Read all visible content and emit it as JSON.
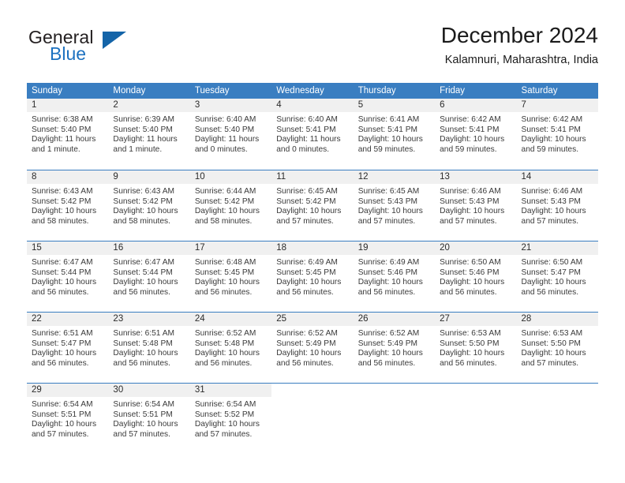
{
  "brand": {
    "word_one": "General",
    "word_two": "Blue",
    "triangle_icon": "triangle-icon"
  },
  "header": {
    "title": "December 2024",
    "subtitle": "Kalamnuri, Maharashtra, India"
  },
  "colors": {
    "header_blue": "#3a7ec1",
    "brand_blue": "#1c71c0",
    "triangle_blue": "#1464a8",
    "day_number_band": "#f0f0f0",
    "text": "#1a1a1a"
  },
  "calendar": {
    "weekdays": [
      "Sunday",
      "Monday",
      "Tuesday",
      "Wednesday",
      "Thursday",
      "Friday",
      "Saturday"
    ],
    "weeks": [
      [
        {
          "day": "1",
          "sunrise": "Sunrise: 6:38 AM",
          "sunset": "Sunset: 5:40 PM",
          "daylight": "Daylight: 11 hours and 1 minute."
        },
        {
          "day": "2",
          "sunrise": "Sunrise: 6:39 AM",
          "sunset": "Sunset: 5:40 PM",
          "daylight": "Daylight: 11 hours and 1 minute."
        },
        {
          "day": "3",
          "sunrise": "Sunrise: 6:40 AM",
          "sunset": "Sunset: 5:40 PM",
          "daylight": "Daylight: 11 hours and 0 minutes."
        },
        {
          "day": "4",
          "sunrise": "Sunrise: 6:40 AM",
          "sunset": "Sunset: 5:41 PM",
          "daylight": "Daylight: 11 hours and 0 minutes."
        },
        {
          "day": "5",
          "sunrise": "Sunrise: 6:41 AM",
          "sunset": "Sunset: 5:41 PM",
          "daylight": "Daylight: 10 hours and 59 minutes."
        },
        {
          "day": "6",
          "sunrise": "Sunrise: 6:42 AM",
          "sunset": "Sunset: 5:41 PM",
          "daylight": "Daylight: 10 hours and 59 minutes."
        },
        {
          "day": "7",
          "sunrise": "Sunrise: 6:42 AM",
          "sunset": "Sunset: 5:41 PM",
          "daylight": "Daylight: 10 hours and 59 minutes."
        }
      ],
      [
        {
          "day": "8",
          "sunrise": "Sunrise: 6:43 AM",
          "sunset": "Sunset: 5:42 PM",
          "daylight": "Daylight: 10 hours and 58 minutes."
        },
        {
          "day": "9",
          "sunrise": "Sunrise: 6:43 AM",
          "sunset": "Sunset: 5:42 PM",
          "daylight": "Daylight: 10 hours and 58 minutes."
        },
        {
          "day": "10",
          "sunrise": "Sunrise: 6:44 AM",
          "sunset": "Sunset: 5:42 PM",
          "daylight": "Daylight: 10 hours and 58 minutes."
        },
        {
          "day": "11",
          "sunrise": "Sunrise: 6:45 AM",
          "sunset": "Sunset: 5:42 PM",
          "daylight": "Daylight: 10 hours and 57 minutes."
        },
        {
          "day": "12",
          "sunrise": "Sunrise: 6:45 AM",
          "sunset": "Sunset: 5:43 PM",
          "daylight": "Daylight: 10 hours and 57 minutes."
        },
        {
          "day": "13",
          "sunrise": "Sunrise: 6:46 AM",
          "sunset": "Sunset: 5:43 PM",
          "daylight": "Daylight: 10 hours and 57 minutes."
        },
        {
          "day": "14",
          "sunrise": "Sunrise: 6:46 AM",
          "sunset": "Sunset: 5:43 PM",
          "daylight": "Daylight: 10 hours and 57 minutes."
        }
      ],
      [
        {
          "day": "15",
          "sunrise": "Sunrise: 6:47 AM",
          "sunset": "Sunset: 5:44 PM",
          "daylight": "Daylight: 10 hours and 56 minutes."
        },
        {
          "day": "16",
          "sunrise": "Sunrise: 6:47 AM",
          "sunset": "Sunset: 5:44 PM",
          "daylight": "Daylight: 10 hours and 56 minutes."
        },
        {
          "day": "17",
          "sunrise": "Sunrise: 6:48 AM",
          "sunset": "Sunset: 5:45 PM",
          "daylight": "Daylight: 10 hours and 56 minutes."
        },
        {
          "day": "18",
          "sunrise": "Sunrise: 6:49 AM",
          "sunset": "Sunset: 5:45 PM",
          "daylight": "Daylight: 10 hours and 56 minutes."
        },
        {
          "day": "19",
          "sunrise": "Sunrise: 6:49 AM",
          "sunset": "Sunset: 5:46 PM",
          "daylight": "Daylight: 10 hours and 56 minutes."
        },
        {
          "day": "20",
          "sunrise": "Sunrise: 6:50 AM",
          "sunset": "Sunset: 5:46 PM",
          "daylight": "Daylight: 10 hours and 56 minutes."
        },
        {
          "day": "21",
          "sunrise": "Sunrise: 6:50 AM",
          "sunset": "Sunset: 5:47 PM",
          "daylight": "Daylight: 10 hours and 56 minutes."
        }
      ],
      [
        {
          "day": "22",
          "sunrise": "Sunrise: 6:51 AM",
          "sunset": "Sunset: 5:47 PM",
          "daylight": "Daylight: 10 hours and 56 minutes."
        },
        {
          "day": "23",
          "sunrise": "Sunrise: 6:51 AM",
          "sunset": "Sunset: 5:48 PM",
          "daylight": "Daylight: 10 hours and 56 minutes."
        },
        {
          "day": "24",
          "sunrise": "Sunrise: 6:52 AM",
          "sunset": "Sunset: 5:48 PM",
          "daylight": "Daylight: 10 hours and 56 minutes."
        },
        {
          "day": "25",
          "sunrise": "Sunrise: 6:52 AM",
          "sunset": "Sunset: 5:49 PM",
          "daylight": "Daylight: 10 hours and 56 minutes."
        },
        {
          "day": "26",
          "sunrise": "Sunrise: 6:52 AM",
          "sunset": "Sunset: 5:49 PM",
          "daylight": "Daylight: 10 hours and 56 minutes."
        },
        {
          "day": "27",
          "sunrise": "Sunrise: 6:53 AM",
          "sunset": "Sunset: 5:50 PM",
          "daylight": "Daylight: 10 hours and 56 minutes."
        },
        {
          "day": "28",
          "sunrise": "Sunrise: 6:53 AM",
          "sunset": "Sunset: 5:50 PM",
          "daylight": "Daylight: 10 hours and 57 minutes."
        }
      ],
      [
        {
          "day": "29",
          "sunrise": "Sunrise: 6:54 AM",
          "sunset": "Sunset: 5:51 PM",
          "daylight": "Daylight: 10 hours and 57 minutes."
        },
        {
          "day": "30",
          "sunrise": "Sunrise: 6:54 AM",
          "sunset": "Sunset: 5:51 PM",
          "daylight": "Daylight: 10 hours and 57 minutes."
        },
        {
          "day": "31",
          "sunrise": "Sunrise: 6:54 AM",
          "sunset": "Sunset: 5:52 PM",
          "daylight": "Daylight: 10 hours and 57 minutes."
        },
        {
          "day": "",
          "sunrise": "",
          "sunset": "",
          "daylight": ""
        },
        {
          "day": "",
          "sunrise": "",
          "sunset": "",
          "daylight": ""
        },
        {
          "day": "",
          "sunrise": "",
          "sunset": "",
          "daylight": ""
        },
        {
          "day": "",
          "sunrise": "",
          "sunset": "",
          "daylight": ""
        }
      ]
    ]
  }
}
